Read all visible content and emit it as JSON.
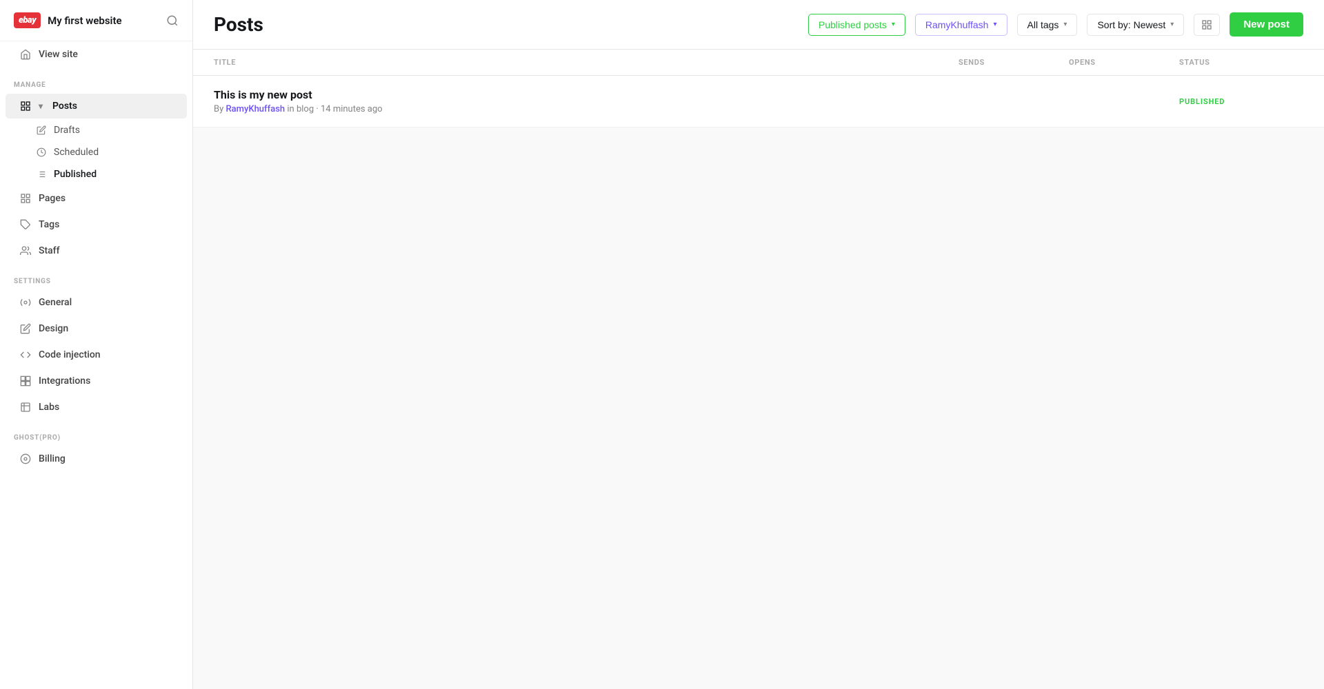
{
  "brand": {
    "logo": "ebay",
    "site_name": "My first website"
  },
  "sidebar": {
    "manage_label": "MANAGE",
    "settings_label": "SETTINGS",
    "ghost_pro_label": "GHOST(PRO)",
    "items": [
      {
        "id": "view-site",
        "label": "View site",
        "icon": "🏠"
      },
      {
        "id": "posts",
        "label": "Posts",
        "icon": "▦",
        "active": true
      },
      {
        "id": "drafts",
        "label": "Drafts",
        "icon": "✏️",
        "sub": true
      },
      {
        "id": "scheduled",
        "label": "Scheduled",
        "icon": "🕐",
        "sub": true
      },
      {
        "id": "published",
        "label": "Published",
        "icon": "≡",
        "sub": true,
        "active": true
      },
      {
        "id": "pages",
        "label": "Pages",
        "icon": "▦"
      },
      {
        "id": "tags",
        "label": "Tags",
        "icon": "🏷"
      },
      {
        "id": "staff",
        "label": "Staff",
        "icon": "👤"
      },
      {
        "id": "general",
        "label": "General",
        "icon": "⚙️"
      },
      {
        "id": "design",
        "label": "Design",
        "icon": "✏️"
      },
      {
        "id": "code-injection",
        "label": "Code injection",
        "icon": "<>"
      },
      {
        "id": "integrations",
        "label": "Integrations",
        "icon": "⊞"
      },
      {
        "id": "labs",
        "label": "Labs",
        "icon": "⚗"
      },
      {
        "id": "billing",
        "label": "Billing",
        "icon": "◉"
      }
    ]
  },
  "header": {
    "page_title": "Posts",
    "filters": {
      "posts_type": "Published posts",
      "author": "RamyKhuffash",
      "tags": "All tags",
      "sort": "Sort by: Newest"
    },
    "new_post_label": "New post"
  },
  "table": {
    "columns": [
      "TITLE",
      "SENDS",
      "OPENS",
      "STATUS"
    ],
    "rows": [
      {
        "title": "This is my new post",
        "author": "RamyKhuffash",
        "category": "blog",
        "time": "14 minutes ago",
        "sends": "",
        "opens": "",
        "status": "PUBLISHED"
      }
    ]
  }
}
